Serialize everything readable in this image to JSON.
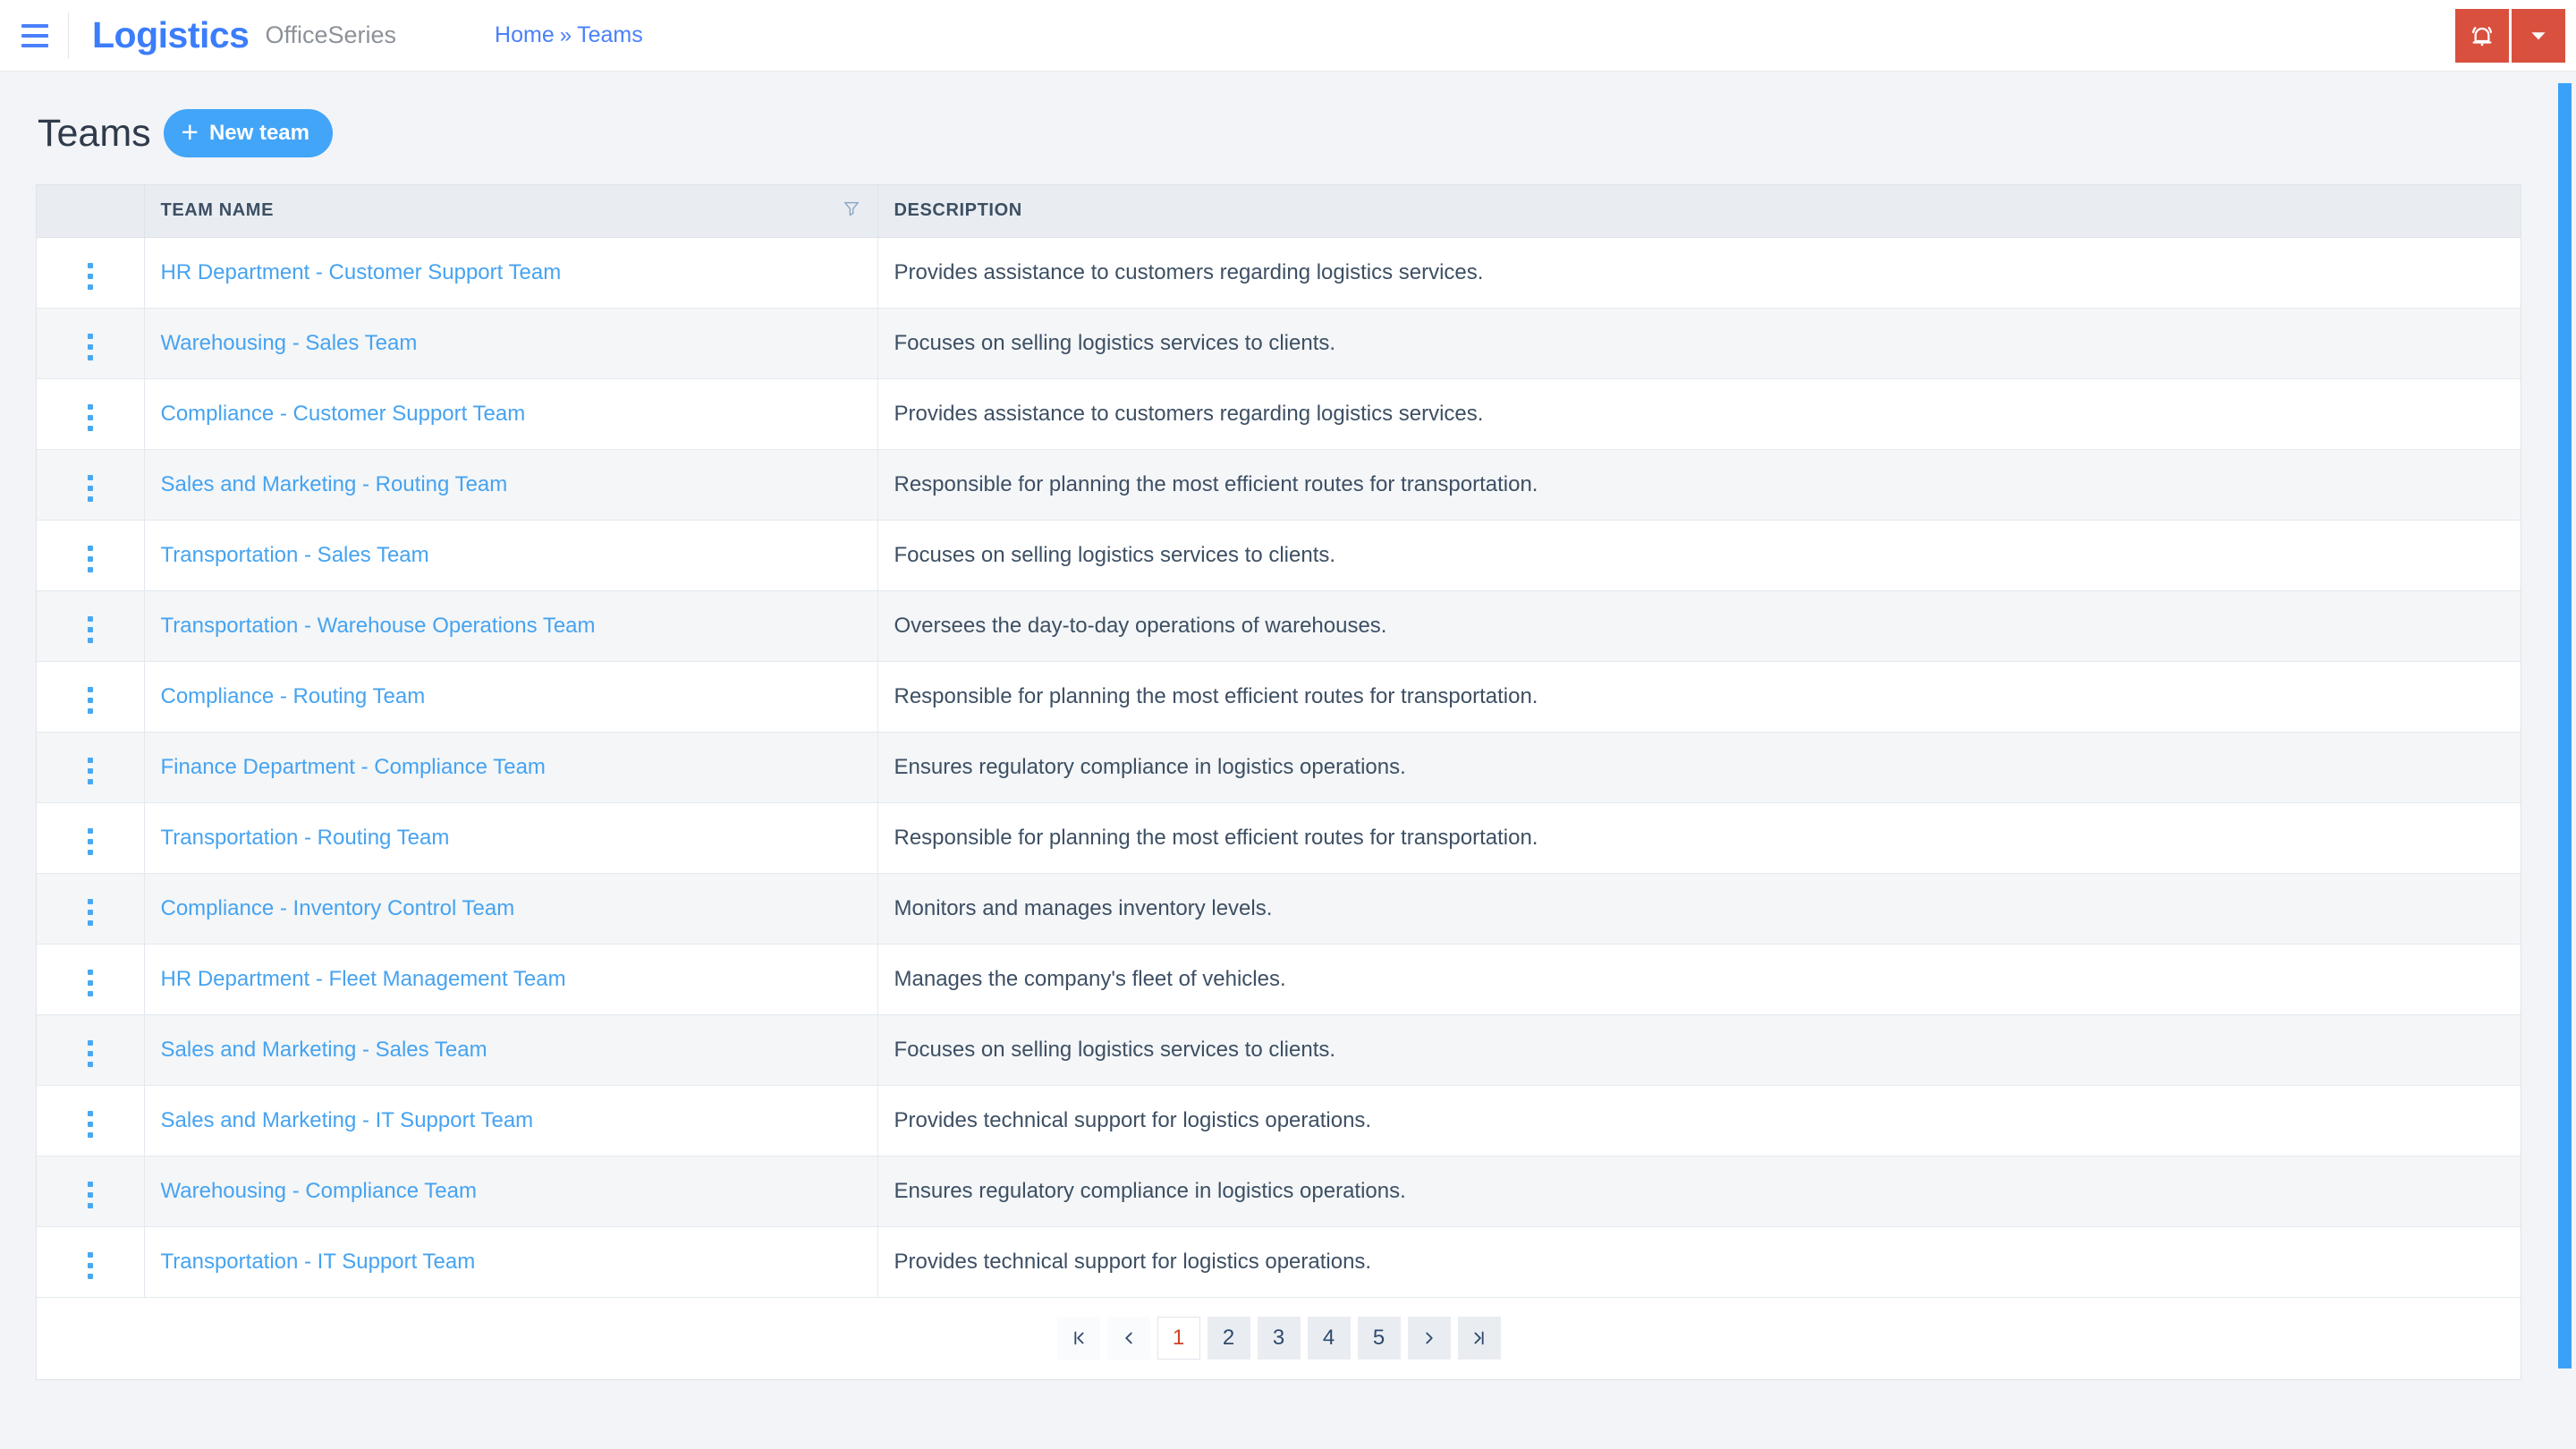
{
  "topbar": {
    "menu_icon": "hamburger-icon",
    "brand": "Logistics",
    "brand_sub": "OfficeSeries",
    "breadcrumb": {
      "home": "Home",
      "separator": "»",
      "current": "Teams"
    },
    "notification_icon": "bell-icon",
    "dropdown_icon": "caret-down-icon",
    "accent_red": "#d9503f",
    "accent_blue": "#3b7dfb"
  },
  "page": {
    "title": "Teams",
    "new_button": {
      "label": "New team",
      "icon": "plus-icon"
    }
  },
  "table": {
    "columns": [
      "",
      "TEAM NAME",
      "DESCRIPTION"
    ],
    "filter_icon": "filter-icon",
    "row_menu_icon": "kebab-menu-icon",
    "rows": [
      {
        "name": "HR Department - Customer Support Team",
        "description": "Provides assistance to customers regarding logistics services."
      },
      {
        "name": "Warehousing - Sales Team",
        "description": "Focuses on selling logistics services to clients."
      },
      {
        "name": "Compliance - Customer Support Team",
        "description": "Provides assistance to customers regarding logistics services."
      },
      {
        "name": "Sales and Marketing - Routing Team",
        "description": "Responsible for planning the most efficient routes for transportation."
      },
      {
        "name": "Transportation - Sales Team",
        "description": "Focuses on selling logistics services to clients."
      },
      {
        "name": "Transportation - Warehouse Operations Team",
        "description": "Oversees the day-to-day operations of warehouses."
      },
      {
        "name": "Compliance - Routing Team",
        "description": "Responsible for planning the most efficient routes for transportation."
      },
      {
        "name": "Finance Department - Compliance Team",
        "description": "Ensures regulatory compliance in logistics operations."
      },
      {
        "name": "Transportation - Routing Team",
        "description": "Responsible for planning the most efficient routes for transportation."
      },
      {
        "name": "Compliance - Inventory Control Team",
        "description": "Monitors and manages inventory levels."
      },
      {
        "name": "HR Department - Fleet Management Team",
        "description": "Manages the company's fleet of vehicles."
      },
      {
        "name": "Sales and Marketing - Sales Team",
        "description": "Focuses on selling logistics services to clients."
      },
      {
        "name": "Sales and Marketing - IT Support Team",
        "description": "Provides technical support for logistics operations."
      },
      {
        "name": "Warehousing - Compliance Team",
        "description": "Ensures regulatory compliance in logistics operations."
      },
      {
        "name": "Transportation - IT Support Team",
        "description": "Provides technical support for logistics operations."
      }
    ]
  },
  "pagination": {
    "first_label": "|<",
    "prev_label": "‹",
    "next_label": "›",
    "last_label": "‾|",
    "pages": [
      "1",
      "2",
      "3",
      "4",
      "5"
    ],
    "active_page": "1",
    "active_color": "#d0412a"
  }
}
